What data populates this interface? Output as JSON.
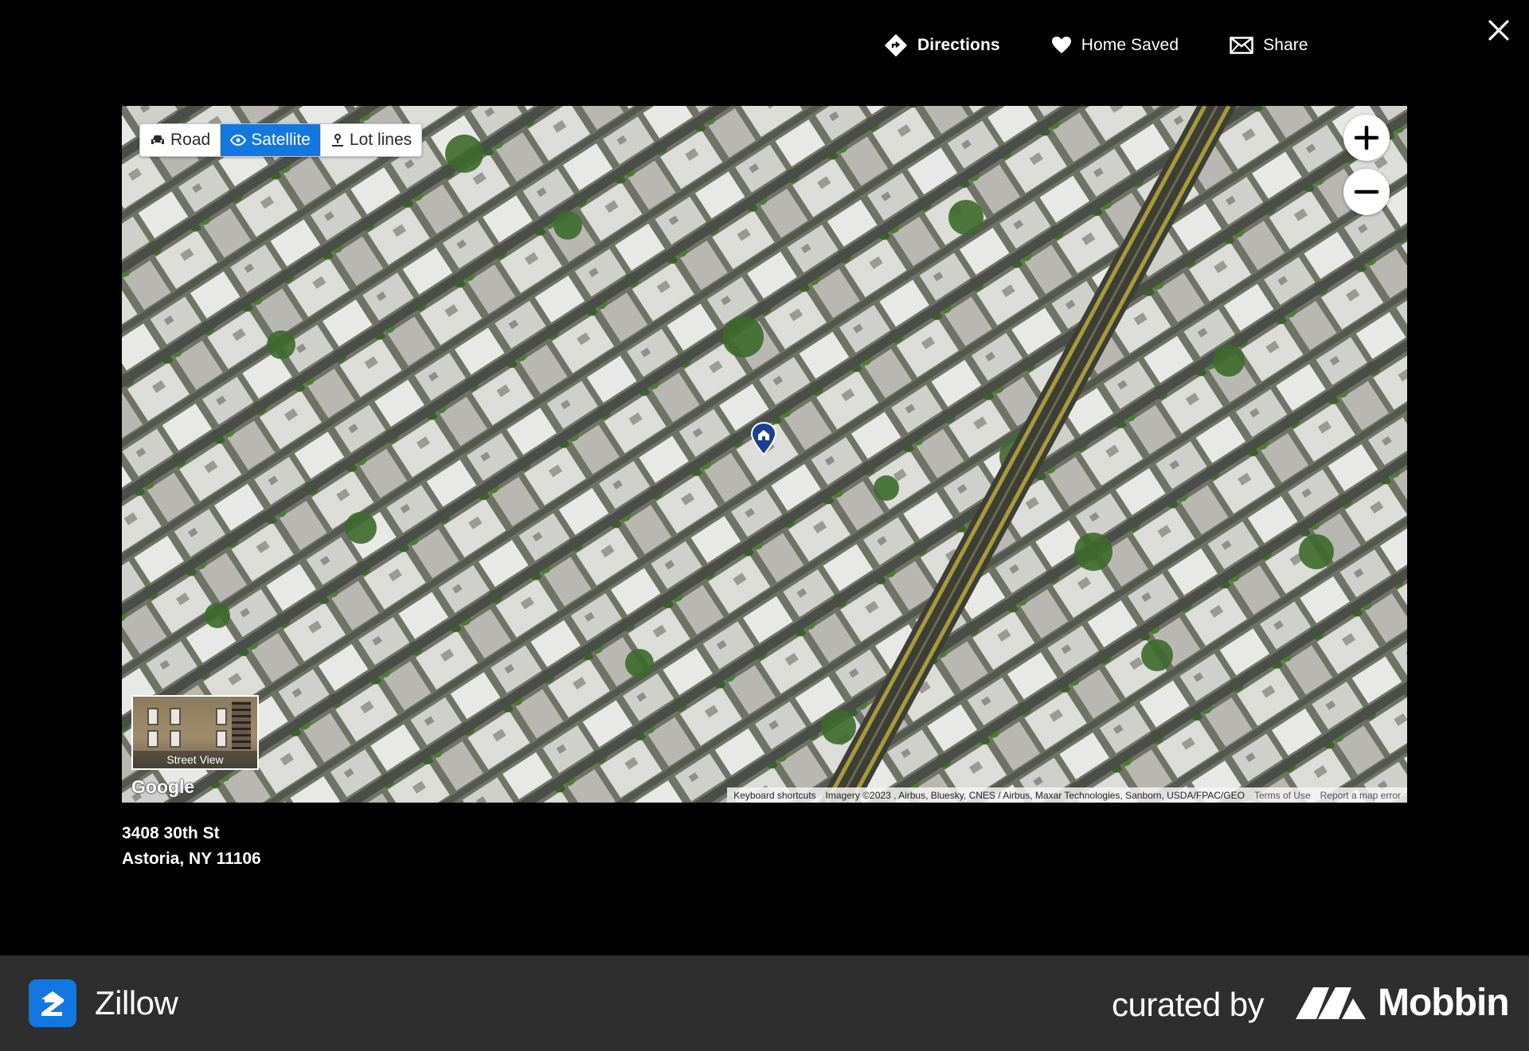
{
  "header": {
    "directions_label": "Directions",
    "saved_label": "Home Saved",
    "share_label": "Share"
  },
  "map": {
    "map_types": [
      {
        "label": "Road",
        "icon": "car-icon",
        "active": false
      },
      {
        "label": "Satellite",
        "icon": "eye-icon",
        "active": true
      },
      {
        "label": "Lot lines",
        "icon": "lot-lines-icon",
        "active": false
      }
    ],
    "street_view_label": "Street View",
    "logo_text": "Google",
    "attribution": {
      "shortcuts": "Keyboard shortcuts",
      "imagery": "Imagery ©2023 , Airbus, Bluesky, CNES / Airbus, Maxar Technologies, Sanborn, USDA/FPAC/GEO",
      "terms": "Terms of Use",
      "report": "Report a map error"
    }
  },
  "address": {
    "line1": "3408 30th St",
    "line2": "Astoria, NY 11106"
  },
  "footer": {
    "app_name": "Zillow",
    "curated_label": "curated by",
    "curator_name": "Mobbin"
  },
  "colors": {
    "background": "#000000",
    "accent": "#1277e1",
    "pin": "#1c3f8f",
    "banner": "#2e2e2e"
  }
}
